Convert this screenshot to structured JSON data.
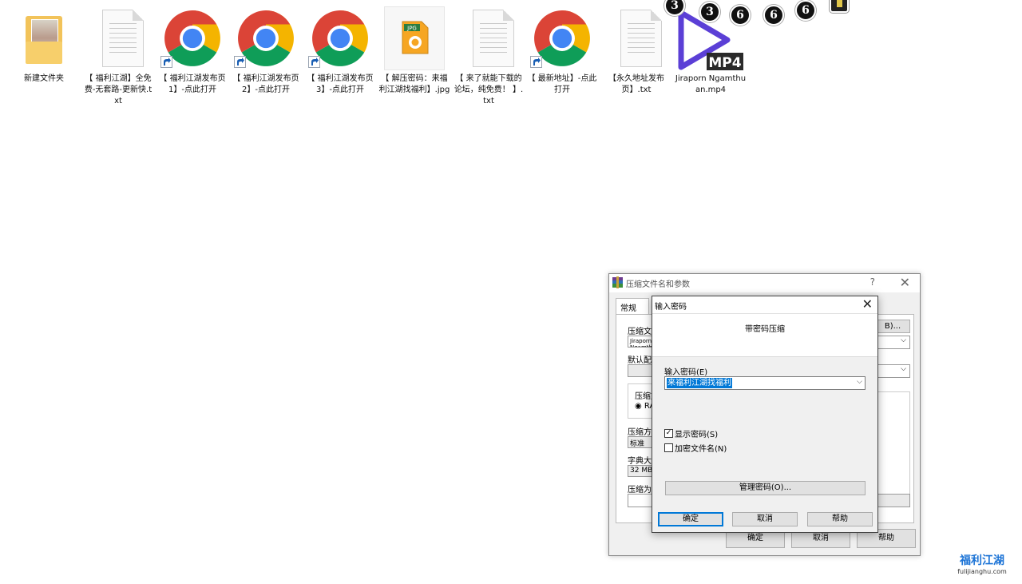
{
  "desktop_icons": [
    {
      "label": "新建文件夹",
      "type": "folder"
    },
    {
      "label": "【 福利江湖】全免费-无套路-更新快.txt",
      "type": "txt"
    },
    {
      "label": "【 福利江湖发布页1】-点此打开",
      "type": "chrome-shortcut"
    },
    {
      "label": "【 福利江湖发布页2】-点此打开",
      "type": "chrome-shortcut"
    },
    {
      "label": "【 福利江湖发布页3】-点此打开",
      "type": "chrome-shortcut"
    },
    {
      "label": "【 解压密码：来福利江湖找福利】.jpg",
      "type": "jpg",
      "badge": "JPG"
    },
    {
      "label": "【 来了就能下载的论坛，纯免费！ 】.txt",
      "type": "txt"
    },
    {
      "label": "【 最新地址】-点此打开",
      "type": "chrome-shortcut"
    },
    {
      "label": "【永久地址发布页】.txt",
      "type": "txt"
    },
    {
      "label": "Jiraporn Ngamthuan.mp4",
      "type": "mp4",
      "badge": "MP4"
    }
  ],
  "discs": [
    "3",
    "3",
    "6",
    "6",
    "6"
  ],
  "back_dialog": {
    "title": "压缩文件名和参数",
    "help": "?",
    "tab_general": "常规",
    "label_archive": "压缩文",
    "archive_value": "Jiraporn Ngamthuan",
    "browse_label": "B)...",
    "label_default": "默认配",
    "label_format": "压缩文",
    "radio_rar": "RA",
    "label_method": "压缩方",
    "method_value": "标准",
    "label_dict": "字典大",
    "dict_value": "32 MB",
    "label_volume": "压缩为",
    "ok": "确定",
    "cancel": "取消",
    "help_btn": "帮助"
  },
  "password_dialog": {
    "title": "输入密码",
    "heading": "带密码压缩",
    "field_label": "输入密码(E)",
    "password_value": "来福利江湖找福利",
    "show_password": "显示密码(S)",
    "show_password_checked": true,
    "encrypt_names": "加密文件名(N)",
    "encrypt_names_checked": false,
    "manage_btn": "管理密码(O)...",
    "ok": "确定",
    "cancel": "取消",
    "help": "帮助"
  },
  "watermark": {
    "main": "福利江湖",
    "sub": "fulijianghu.com"
  },
  "colors": {
    "accent": "#0078d7",
    "chrome_red": "#db4437",
    "chrome_green": "#0f9d58",
    "chrome_yellow": "#f4b400",
    "chrome_blue": "#4285f4",
    "mp4_purple": "#5b3fd6"
  }
}
